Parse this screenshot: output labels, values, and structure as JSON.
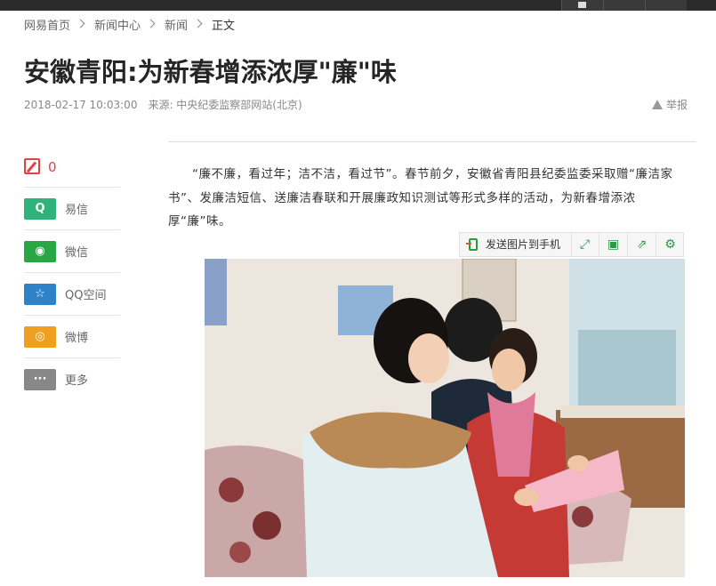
{
  "breadcrumb": [
    "网易首页",
    "新闻中心",
    "新闻",
    "正文"
  ],
  "article": {
    "title": "安徽青阳:为新春增添浓厚\"廉\"味",
    "datetime": "2018-02-17 10:03:00",
    "source": "来源: 中央纪委监察部网站(北京)",
    "report_label": "举报",
    "paragraph": "“廉不廉，看过年；洁不洁，看过节”。春节前夕，安徽省青阳县纪委监委采取赠“廉洁家书”、发廉洁短信、送廉洁春联和开展廉政知识测试等形式多样的活动，为新春增添浓厚“廉”味。"
  },
  "comments": {
    "count": "0"
  },
  "share": [
    {
      "label": "易信",
      "color": "#2fb37a",
      "icon": "yixin-icon"
    },
    {
      "label": "微信",
      "color": "#2aa745",
      "icon": "wechat-icon"
    },
    {
      "label": "QQ空间",
      "color": "#2e82c8",
      "icon": "qzone-icon"
    },
    {
      "label": "微博",
      "color": "#f0a020",
      "icon": "weibo-icon"
    },
    {
      "label": "更多",
      "color": "#888888",
      "icon": "more-icon"
    }
  ],
  "image_toolbar": {
    "send_label": "发送图片到手机",
    "buttons": [
      "fullscreen-icon",
      "save-icon",
      "share-icon",
      "settings-icon"
    ]
  },
  "colors": {
    "accent": "#2a9a45",
    "comment": "#e04343"
  }
}
